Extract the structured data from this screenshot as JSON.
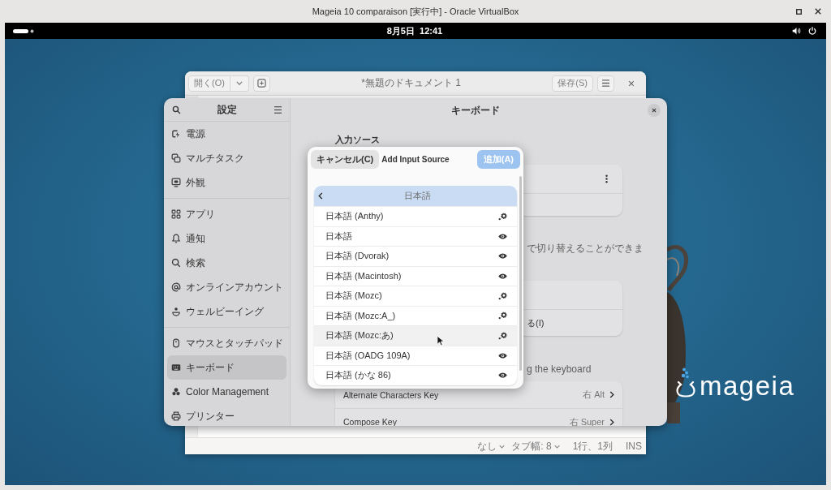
{
  "host_window": {
    "title": "Mageia 10 comparaison [実行中] - Oracle VirtualBox"
  },
  "top_bar": {
    "clock": "8月5日  12:41"
  },
  "desktop": {
    "logo_text": "mageia"
  },
  "editor": {
    "open_button": "開く(O)",
    "title": "*無題のドキュメント 1",
    "save_button": "保存(S)",
    "status_bar": [
      {
        "label": "なし",
        "kind": "dropdown"
      },
      {
        "label": "タブ幅: 8",
        "kind": "dropdown"
      },
      {
        "label": "1行、1列",
        "kind": "text"
      },
      {
        "label": "INS",
        "kind": "text"
      }
    ]
  },
  "settings": {
    "sidebar": {
      "title": "設定",
      "groups": [
        {
          "items": [
            {
              "label": "電源",
              "selected": false
            },
            {
              "label": "マルチタスク",
              "selected": false
            },
            {
              "label": "外観",
              "selected": false
            }
          ]
        },
        {
          "items": [
            {
              "label": "アプリ",
              "selected": false
            },
            {
              "label": "通知",
              "selected": false
            },
            {
              "label": "検索",
              "selected": false
            },
            {
              "label": "オンラインアカウント",
              "selected": false
            },
            {
              "label": "ウェルビーイング",
              "selected": false
            }
          ]
        },
        {
          "items": [
            {
              "label": "マウスとタッチパッド",
              "selected": false
            },
            {
              "label": "キーボード",
              "selected": true
            },
            {
              "label": "Color Management",
              "selected": false
            },
            {
              "label": "プリンター",
              "selected": false
            }
          ]
        }
      ]
    },
    "page": {
      "title": "キーボード",
      "input_sources_heading": "入力ソース",
      "switch_hint": "で切り替えることができま",
      "switch_option": "る(I)",
      "special_hint": "g the keyboard",
      "special_rows": [
        {
          "label": "Alternate Characters Key",
          "value": "右 Alt"
        },
        {
          "label": "Compose Key",
          "value": "右 Super"
        }
      ]
    }
  },
  "dialog": {
    "cancel_button": "キャンセル(C)",
    "title": "Add Input Source",
    "add_button": {
      "label": "追加(A)",
      "disabled": true
    },
    "category": "日本語",
    "items": [
      {
        "label": "日本語 (Anthy)",
        "kind": "engine",
        "hovered": false
      },
      {
        "label": "日本語",
        "kind": "layout",
        "hovered": false
      },
      {
        "label": "日本語 (Dvorak)",
        "kind": "layout",
        "hovered": false
      },
      {
        "label": "日本語 (Macintosh)",
        "kind": "layout",
        "hovered": false
      },
      {
        "label": "日本語 (Mozc)",
        "kind": "engine",
        "hovered": false
      },
      {
        "label": "日本語 (Mozc:A_)",
        "kind": "engine",
        "hovered": false
      },
      {
        "label": "日本語 (Mozc:あ)",
        "kind": "engine",
        "hovered": true
      },
      {
        "label": "日本語 (OADG 109A)",
        "kind": "layout",
        "hovered": false
      },
      {
        "label": "日本語 (かな 86)",
        "kind": "layout",
        "hovered": false
      }
    ]
  }
}
